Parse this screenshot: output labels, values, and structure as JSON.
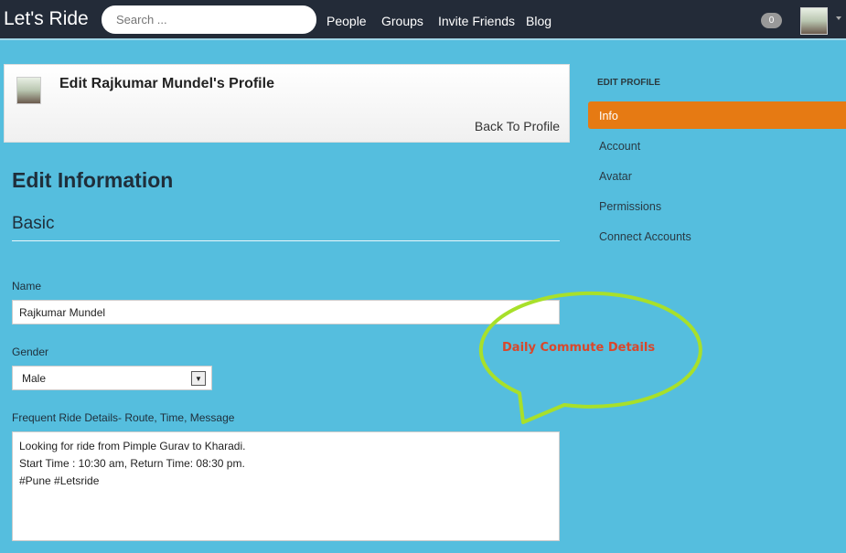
{
  "nav": {
    "brand": "Let's Ride",
    "search_placeholder": "Search ...",
    "links": [
      "People",
      "Groups",
      "Invite Friends",
      "Blog"
    ],
    "notification_count": "0"
  },
  "card": {
    "title": "Edit Rajkumar Mundel's Profile",
    "back_link": "Back To Profile"
  },
  "form": {
    "heading": "Edit Information",
    "section": "Basic",
    "name_label": "Name",
    "name_value": "Rajkumar Mundel",
    "gender_label": "Gender",
    "gender_value": "Male",
    "ride_label": "Frequent Ride Details- Route, Time, Message",
    "ride_value": "Looking for ride from Pimple Gurav to Kharadi.\nStart Time : 10:30 am, Return Time: 08:30 pm.\n#Pune #Letsride"
  },
  "sidebar": {
    "heading": "EDIT PROFILE",
    "items": [
      "Info",
      "Account",
      "Avatar",
      "Permissions",
      "Connect Accounts"
    ],
    "active": "Info"
  },
  "annotation": {
    "text": "Daily Commute Details",
    "stroke": "#a8e02a",
    "text_color": "#d9472b"
  },
  "colors": {
    "background": "#55bede",
    "navbar": "#232b38",
    "active": "#e67a13"
  }
}
